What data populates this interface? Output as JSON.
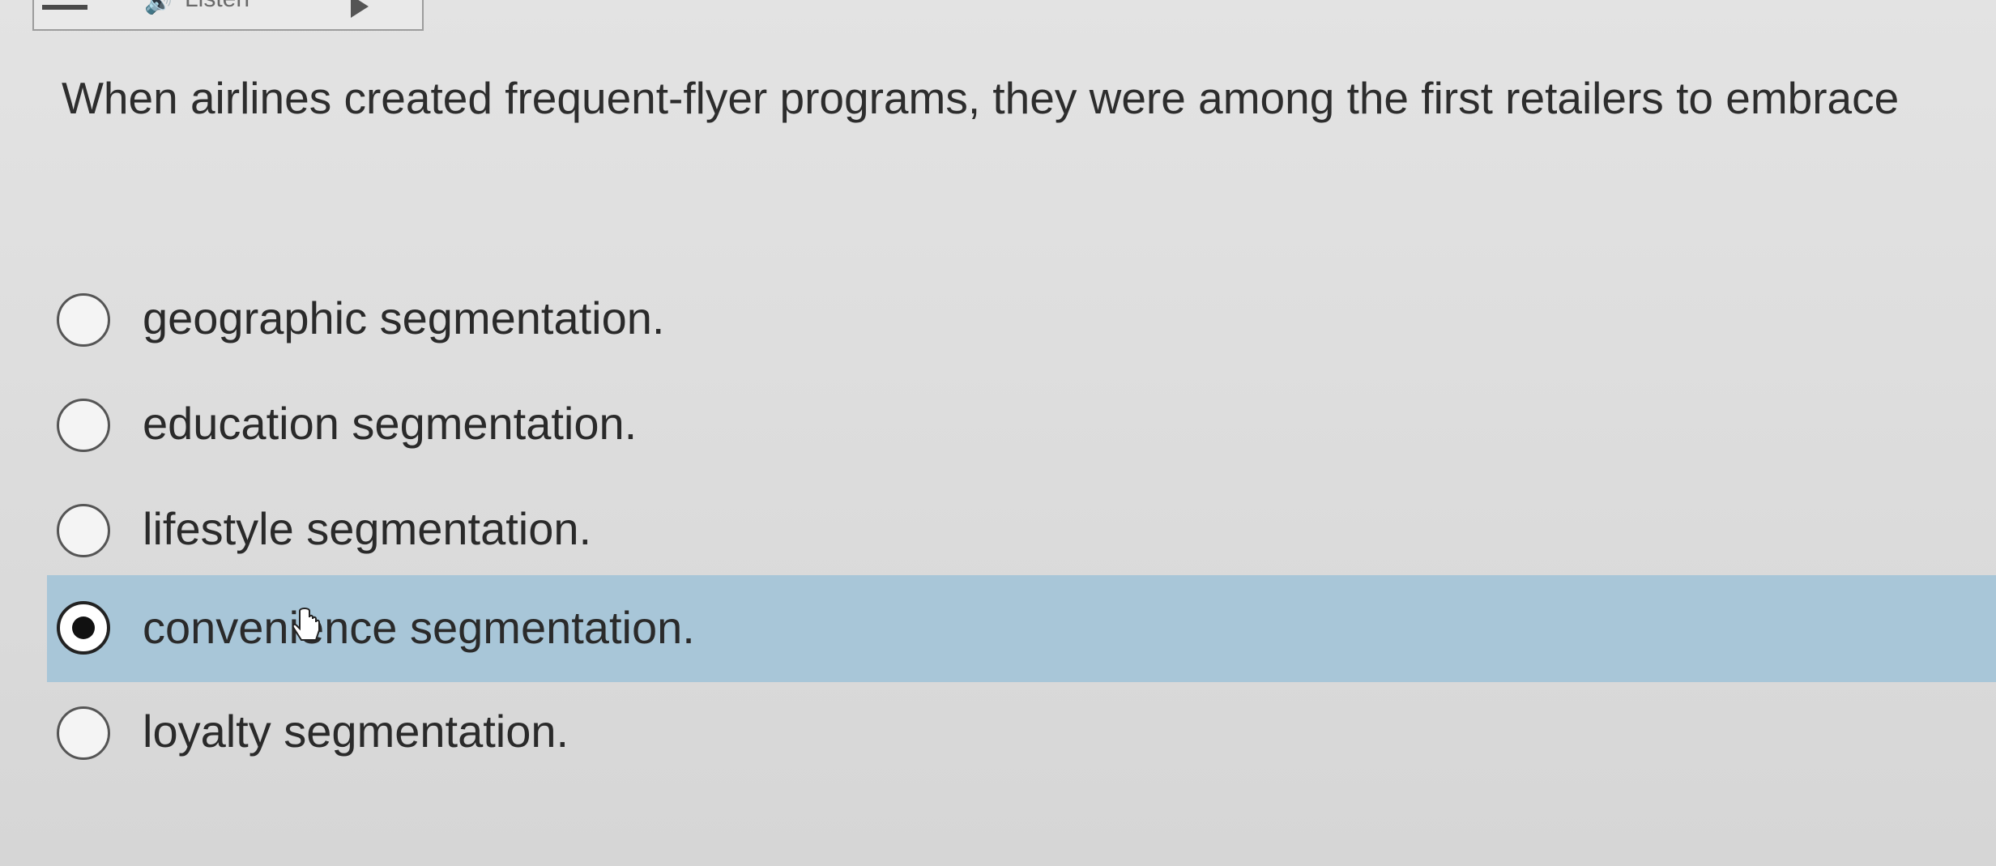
{
  "toolbar": {
    "listen_label": "Listen",
    "icons": [
      "menu-icon",
      "speaker-icon",
      "play-icon"
    ]
  },
  "question": {
    "text": "When airlines created frequent-flyer programs, they were among the first retailers to embrace"
  },
  "options": [
    {
      "label": "geographic segmentation.",
      "selected": false
    },
    {
      "label": "education segmentation.",
      "selected": false
    },
    {
      "label": "lifestyle segmentation.",
      "selected": false
    },
    {
      "label": "convenience segmentation.",
      "selected": true
    },
    {
      "label": "loyalty segmentation.",
      "selected": false
    }
  ],
  "colors": {
    "selected_row": "#a8c6d8",
    "text": "#2a2a2a",
    "background": "#dedede"
  }
}
